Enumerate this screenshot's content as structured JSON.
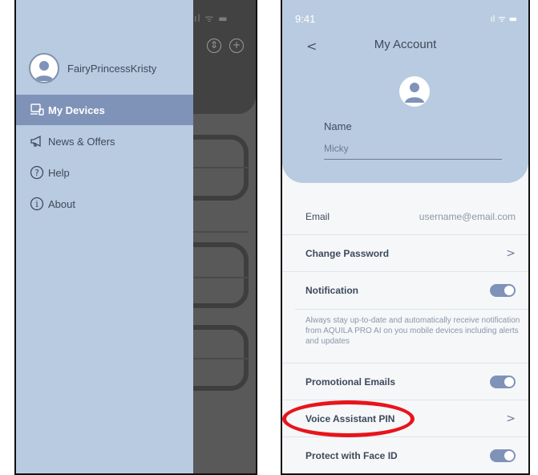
{
  "left_screen": {
    "status_bar": {
      "icons": "ıl ᯤ ▬"
    },
    "background_icons": [
      "sort-icon",
      "add-icon"
    ],
    "drawer": {
      "username": "FairyPrincessKristy",
      "menu": [
        {
          "label": "My Devices",
          "icon": "devices-icon",
          "active": true
        },
        {
          "label": "News & Offers",
          "icon": "megaphone-icon",
          "active": false
        },
        {
          "label": "Help",
          "icon": "help-icon",
          "active": false
        },
        {
          "label": "About",
          "icon": "info-icon",
          "active": false
        }
      ]
    }
  },
  "right_screen": {
    "status_bar": {
      "time": "9:41",
      "icons": "ıl ᯤ ▬"
    },
    "header": {
      "back": "<",
      "title": "My Account",
      "name_label": "Name",
      "name_value": "Micky"
    },
    "rows": {
      "email": {
        "label": "Email",
        "value": "username@email.com"
      },
      "change_password": {
        "label": "Change Password",
        "chevron": ">"
      },
      "notification": {
        "label": "Notification",
        "enabled": true,
        "description": "Always stay up-to-date and automatically receive notification from AQUILA PRO AI on you mobile devices including alerts and updates"
      },
      "promotional_emails": {
        "label": "Promotional Emails",
        "enabled": true
      },
      "voice_assistant_pin": {
        "label": "Voice Assistant PIN",
        "chevron": ">"
      },
      "face_id": {
        "label": "Protect with Face ID",
        "enabled": true
      }
    }
  },
  "colors": {
    "accent": "#7f93b8",
    "header_bg": "#b9cbe0",
    "highlight": "#e8141b",
    "text": "#3d4a5c"
  }
}
